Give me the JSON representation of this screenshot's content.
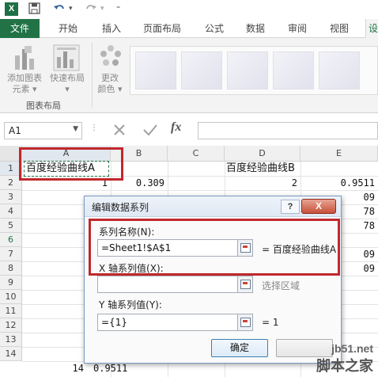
{
  "app": {
    "logo": "X",
    "icons": [
      "save-icon",
      "undo-icon",
      "redo-icon",
      "customize-qat-icon"
    ]
  },
  "ribbon_tabs": [
    {
      "label": "文件"
    },
    {
      "label": "开始"
    },
    {
      "label": "插入"
    },
    {
      "label": "页面布局"
    },
    {
      "label": "公式"
    },
    {
      "label": "数据"
    },
    {
      "label": "审阅"
    },
    {
      "label": "视图"
    },
    {
      "label": "设"
    }
  ],
  "ribbon": {
    "add_chart_element": [
      "添加图表",
      "元素 ▾"
    ],
    "quick_layout": [
      "快速布局",
      "▾"
    ],
    "change_colors": [
      "更改",
      "颜色 ▾"
    ],
    "group_label": "图表布局"
  },
  "formula_bar": {
    "name_box": "A1",
    "fx": "fx"
  },
  "sheet": {
    "columns": [
      "A",
      "B",
      "C",
      "D",
      "E"
    ],
    "rows": [
      "1",
      "2",
      "3",
      "4",
      "5",
      "6",
      "7",
      "8",
      "9",
      "10",
      "11",
      "12",
      "13",
      "14"
    ],
    "cells": {
      "A1": "百度经验曲线A",
      "D1": "百度经验曲线B",
      "A2": "1",
      "B2": "0.309",
      "D2": "2",
      "E2": "0.9511",
      "E3": "09",
      "E4": "78",
      "E5": "78",
      "E7": "09",
      "E8": "09",
      "A14": "14",
      "B14": "0.9511"
    }
  },
  "dialog": {
    "title": "编辑数据系列",
    "help": "?",
    "close": "X",
    "series_name_label": "系列名称(N):",
    "series_name_value": "=Sheet1!$A$1",
    "series_name_result": "= 百度经验曲线A",
    "x_values_label": "X 轴系列值(X):",
    "x_values_value": "",
    "x_values_result": "选择区域",
    "y_values_label": "Y 轴系列值(Y):",
    "y_values_value": "={1}",
    "y_values_result": "= 1",
    "ok_label": "确定"
  },
  "watermark": {
    "line1": "jb51.net",
    "line2": "脚本之家"
  },
  "colors": {
    "excel_green": "#217346",
    "highlight_red": "#c0282d"
  }
}
